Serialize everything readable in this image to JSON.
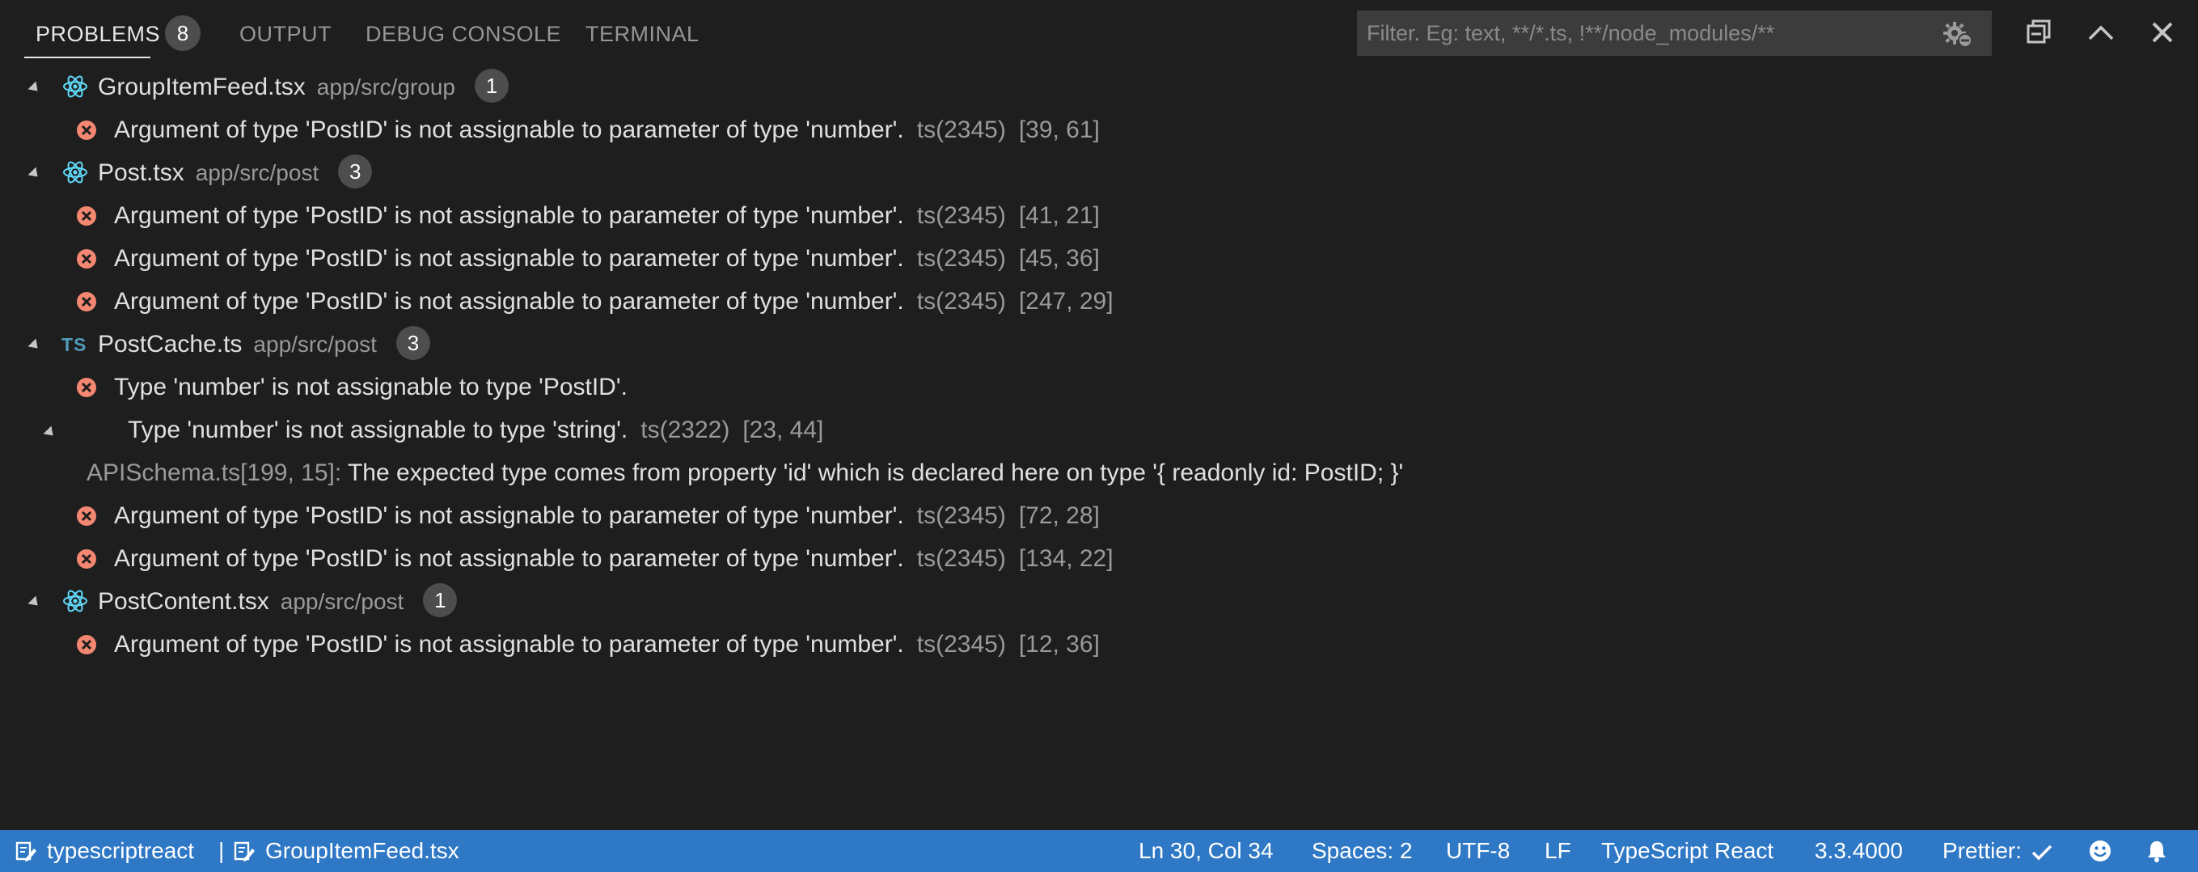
{
  "panel": {
    "tabs": [
      {
        "label": "PROBLEMS",
        "active": true
      },
      {
        "label": "OUTPUT",
        "active": false
      },
      {
        "label": "DEBUG CONSOLE",
        "active": false
      },
      {
        "label": "TERMINAL",
        "active": false
      }
    ],
    "problems_count": "8",
    "filter": {
      "placeholder": "Filter. Eg: text, **/*.ts, !**/node_modules/**",
      "value": ""
    },
    "header_icons": [
      "filter-gear-icon",
      "collapse-all-icon",
      "maximize-panel-icon",
      "close-panel-icon"
    ]
  },
  "problems": {
    "files": [
      {
        "name": "GroupItemFeed.tsx",
        "path": "app/src/group",
        "count": "1",
        "icon": "react-icon",
        "items": [
          {
            "message": "Argument of type 'PostID' is not assignable to parameter of type 'number'.",
            "code": "ts(2345)",
            "location": "[39, 61]"
          }
        ]
      },
      {
        "name": "Post.tsx",
        "path": "app/src/post",
        "count": "3",
        "icon": "react-icon",
        "items": [
          {
            "message": "Argument of type 'PostID' is not assignable to parameter of type 'number'.",
            "code": "ts(2345)",
            "location": "[41, 21]"
          },
          {
            "message": "Argument of type 'PostID' is not assignable to parameter of type 'number'.",
            "code": "ts(2345)",
            "location": "[45, 36]"
          },
          {
            "message": "Argument of type 'PostID' is not assignable to parameter of type 'number'.",
            "code": "ts(2345)",
            "location": "[247, 29]"
          }
        ]
      },
      {
        "name": "PostCache.ts",
        "path": "app/src/post",
        "count": "3",
        "icon": "typescript-icon",
        "icon_text": "TS",
        "items": [
          {
            "message": "Type 'number' is not assignable to type 'PostID'.",
            "detail": {
              "message": "Type 'number' is not assignable to type 'string'.",
              "code": "ts(2322)",
              "location": "[23, 44]"
            },
            "related": {
              "source": "APISchema.ts[199, 15]:",
              "message": "The expected type comes from property 'id' which is declared here on type '{ readonly id: PostID; }'"
            }
          },
          {
            "message": "Argument of type 'PostID' is not assignable to parameter of type 'number'.",
            "code": "ts(2345)",
            "location": "[72, 28]"
          },
          {
            "message": "Argument of type 'PostID' is not assignable to parameter of type 'number'.",
            "code": "ts(2345)",
            "location": "[134, 22]"
          }
        ]
      },
      {
        "name": "PostContent.tsx",
        "path": "app/src/post",
        "count": "1",
        "icon": "react-icon",
        "items": [
          {
            "message": "Argument of type 'PostID' is not assignable to parameter of type 'number'.",
            "code": "ts(2345)",
            "location": "[12, 36]"
          }
        ]
      }
    ]
  },
  "status_bar": {
    "background": "#2e78c5",
    "language_mode": "typescriptreact",
    "separator": "|",
    "active_file": "GroupItemFeed.tsx",
    "cursor": "Ln 30, Col 34",
    "indentation": "Spaces: 2",
    "encoding": "UTF-8",
    "eol": "LF",
    "language": "TypeScript React",
    "ts_version": "3.3.4000",
    "prettier": "Prettier:",
    "icons": [
      "edit-file-icon",
      "check-icon",
      "feedback-smiley-icon",
      "notifications-bell-icon"
    ]
  },
  "colors": {
    "background": "#1e1e1e",
    "error": "#f48771",
    "badge": "#4d4d4d",
    "react": "#61dafb",
    "typescript": "#519aba"
  }
}
